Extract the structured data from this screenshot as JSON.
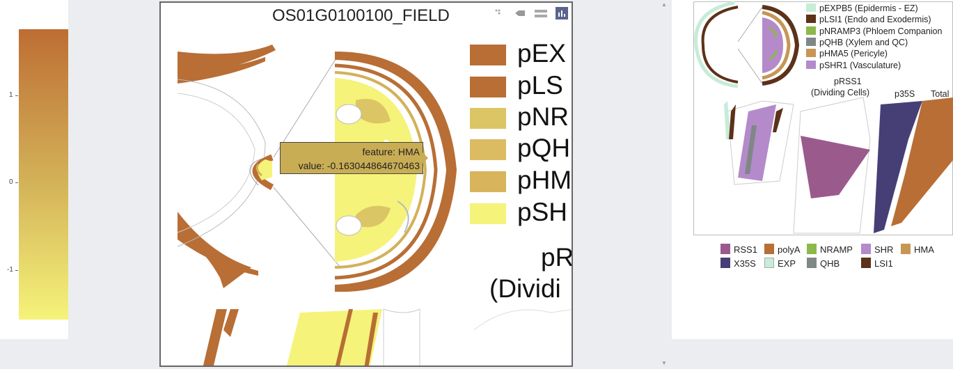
{
  "colorbar": {
    "ticks": [
      "1",
      "0",
      "-1"
    ],
    "gradient_top": "#bd6e33",
    "gradient_mid": "#d3b158",
    "gradient_bottom": "#f5f37a"
  },
  "main_plot": {
    "title": "OS01G0100100_FIELD",
    "tooltip": {
      "feature_line": "feature: HMA",
      "value_line": "value: -0.163044864670463"
    },
    "legend_items": [
      {
        "label": "pEX",
        "color": "#b86e35"
      },
      {
        "label": "pLS",
        "color": "#b86e35"
      },
      {
        "label": "pNR",
        "color": "#dcc565"
      },
      {
        "label": "pQH",
        "color": "#dbbc62"
      },
      {
        "label": "pHM",
        "color": "#d8b45c"
      },
      {
        "label": "pSH",
        "color": "#f5f37a"
      }
    ],
    "pr_label": "pR",
    "dividing_label": "(Dividi"
  },
  "toolbar": {
    "icons": [
      "pan-icon",
      "select-icon",
      "zoom-icon",
      "compare-icon",
      "bar-chart-icon"
    ]
  },
  "reference": {
    "legend": [
      {
        "label": "pEXPB5 (Epidermis - EZ)",
        "color": "#c7ecd8"
      },
      {
        "label": "pLSI1 (Endo and Exodermis)",
        "color": "#5c3218"
      },
      {
        "label": "pNRAMP3 (Phloem Companion",
        "color": "#8db84a"
      },
      {
        "label": "pQHB (Xylem and QC)",
        "color": "#7f8787"
      },
      {
        "label": "pHMA5 (Pericyle)",
        "color": "#c79655"
      },
      {
        "label": "pSHR1 (Vasculature)",
        "color": "#b48acb"
      }
    ],
    "label_rss1": "pRSS1",
    "label_dividing": "(Dividing Cells)",
    "label_p35s": "p35S",
    "label_total": "Total",
    "bottom_legend": [
      {
        "label": "RSS1",
        "color": "#9b5a8c"
      },
      {
        "label": "polyA",
        "color": "#b86e35"
      },
      {
        "label": "NRAMP",
        "color": "#8db84a"
      },
      {
        "label": "SHR",
        "color": "#b48acb"
      },
      {
        "label": "HMA",
        "color": "#c79655"
      },
      {
        "label": "X35S",
        "color": "#463f76"
      },
      {
        "label": "EXP",
        "color": "#c7ecd8"
      },
      {
        "label": "QHB",
        "color": "#7f8787"
      },
      {
        "label": "LSI1",
        "color": "#5c3218"
      }
    ]
  }
}
